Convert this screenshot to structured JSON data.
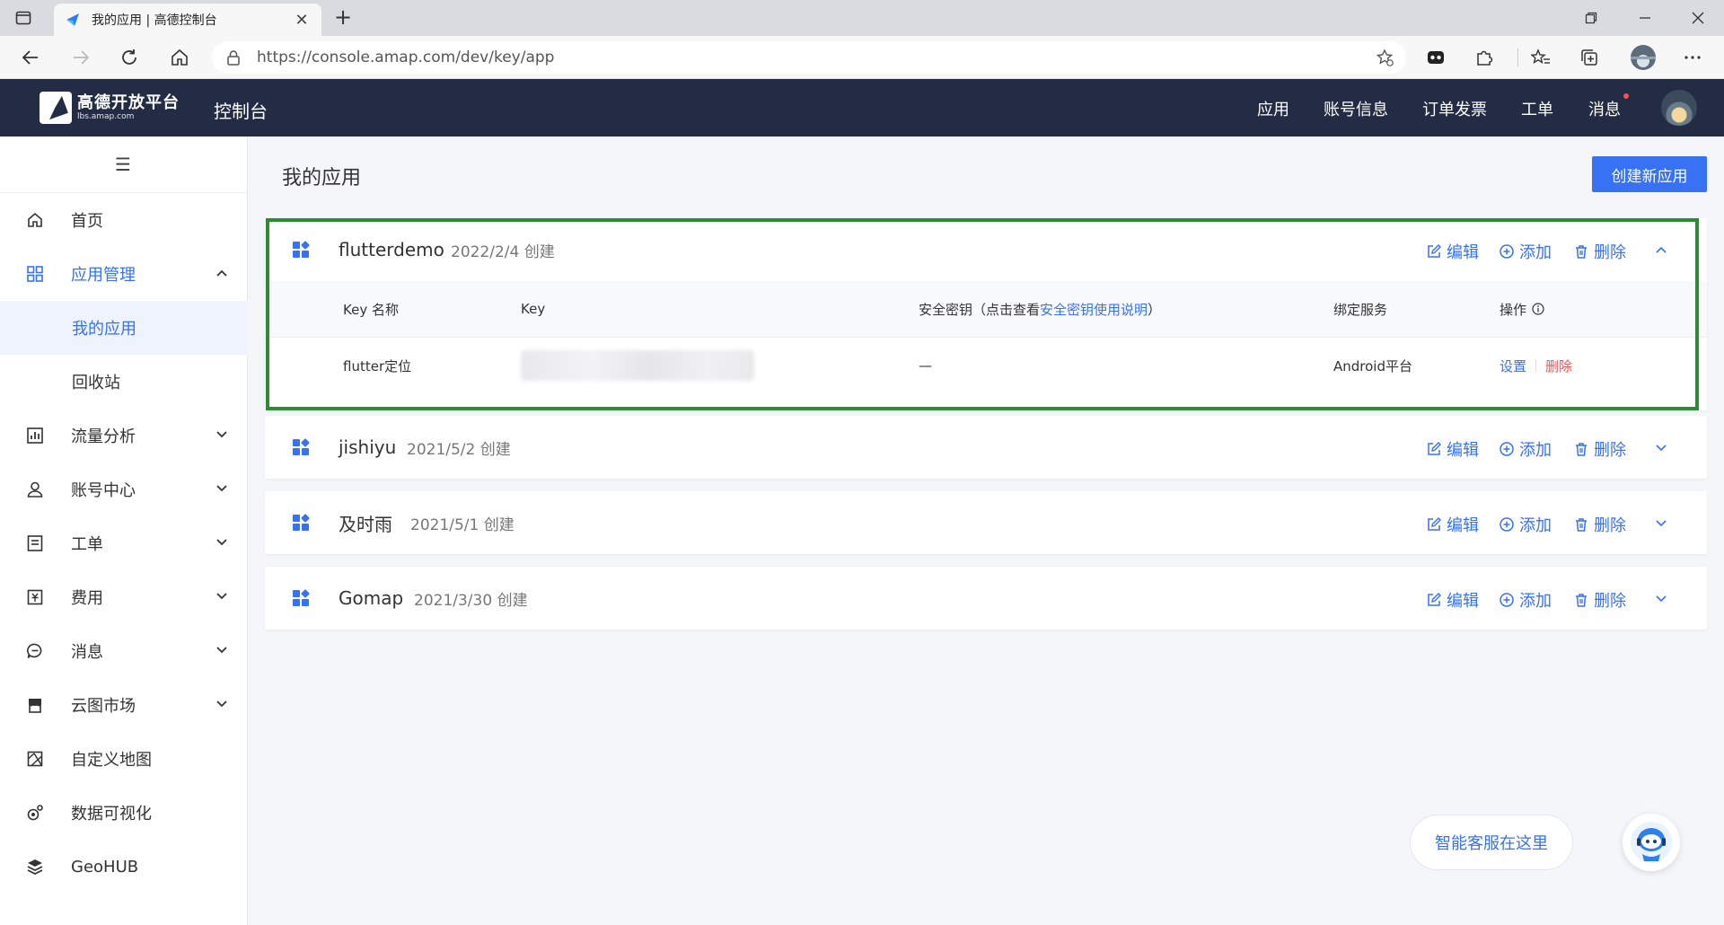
{
  "browser": {
    "tab_title": "我的应用 | 高德控制台",
    "url": "https://console.amap.com/dev/key/app"
  },
  "header": {
    "brand": "高德开放平台",
    "domain": "lbs.amap.com",
    "console": "控制台",
    "nav": [
      "应用",
      "账号信息",
      "订单发票",
      "工单",
      "消息"
    ]
  },
  "sidebar": {
    "items": [
      {
        "label": "首页",
        "icon": "home-icon"
      },
      {
        "label": "应用管理",
        "icon": "apps-grid-icon"
      },
      {
        "label": "我的应用"
      },
      {
        "label": "回收站"
      },
      {
        "label": "流量分析",
        "icon": "chart-icon"
      },
      {
        "label": "账号中心",
        "icon": "user-icon"
      },
      {
        "label": "工单",
        "icon": "ticket-icon"
      },
      {
        "label": "费用",
        "icon": "fee-icon"
      },
      {
        "label": "消息",
        "icon": "message-icon"
      },
      {
        "label": "云图市场",
        "icon": "store-icon"
      },
      {
        "label": "自定义地图",
        "icon": "map-icon"
      },
      {
        "label": "数据可视化",
        "icon": "visual-icon"
      },
      {
        "label": "GeoHUB",
        "icon": "layers-icon"
      }
    ]
  },
  "main": {
    "title": "我的应用",
    "create_button": "创建新应用",
    "actions": {
      "edit": "编辑",
      "add": "添加",
      "delete": "删除"
    },
    "apps": [
      {
        "name": "flutterdemo",
        "date": "2022/2/4 创建"
      },
      {
        "name": "jishiyu",
        "date": "2021/5/2 创建"
      },
      {
        "name": "及时雨",
        "date": "2021/5/1 创建"
      },
      {
        "name": "Gomap",
        "date": "2021/3/30 创建"
      }
    ],
    "key_table": {
      "headers": {
        "key_name": "Key 名称",
        "key": "Key",
        "secret_prefix": "安全密钥（点击查看",
        "secret_link": "安全密钥使用说明",
        "secret_suffix": "）",
        "service": "绑定服务",
        "ops": "操作"
      },
      "rows": [
        {
          "key_name": "flutter定位",
          "key": "",
          "secret": "—",
          "service": "Android平台",
          "op_set": "设置",
          "op_delete": "删除"
        }
      ]
    }
  },
  "chat": {
    "label": "智能客服在这里"
  },
  "colors": {
    "primary": "#3771f4",
    "header_bg": "#232c44",
    "danger": "#ff4d4f",
    "highlight": "#2e8b35"
  }
}
